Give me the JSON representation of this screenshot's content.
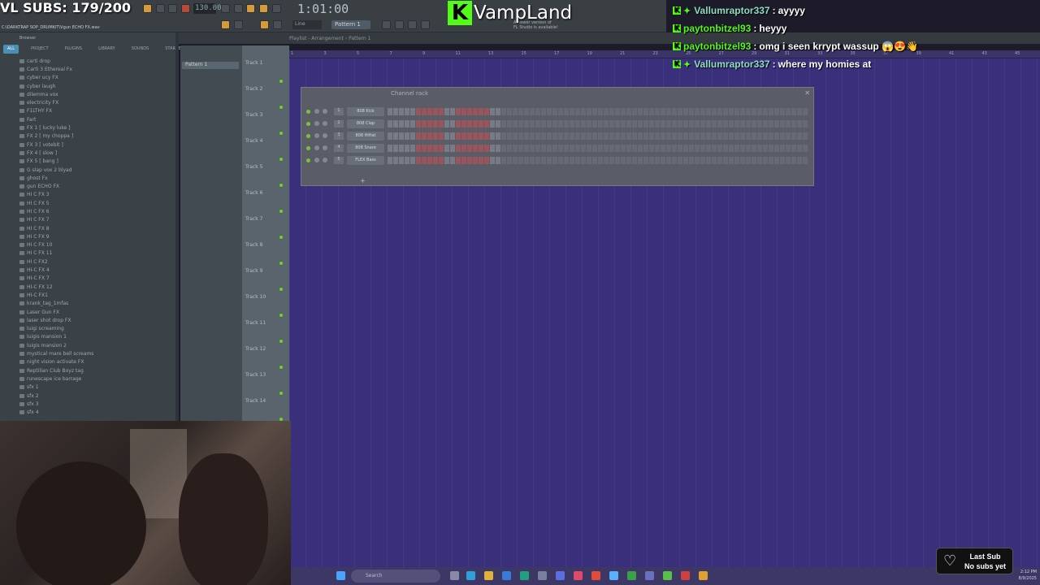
{
  "overlay": {
    "subs_counter": "VL SUBS: 179/200",
    "logo_text": "VampLand"
  },
  "fl": {
    "tempo": "130.000",
    "time": "1:01:00",
    "file_path": "C:\\DARKTRAP SOP_DRUMKIT\\Vgun ECHO FX.wav",
    "snap": "Line",
    "pattern": "Pattern 1",
    "notice_line1": "A newer version of",
    "notice_line2": "FL Studio is available!"
  },
  "chat": [
    {
      "user": "Vallumraptor337",
      "text": "ayyyy",
      "sparkle": true
    },
    {
      "user": "paytonbitzel93",
      "text": "heyyy",
      "sparkle": false
    },
    {
      "user": "paytonbitzel93",
      "text": "omg i seen krrypt wassup 😱😍👋",
      "sparkle": false
    },
    {
      "user": "Vallumraptor337",
      "text": "where my homies at",
      "sparkle": true
    }
  ],
  "browser": {
    "title": "Browser",
    "tabs": [
      "ALL",
      "PROJECT",
      "PLUGINS",
      "LIBRARY",
      "SOUNDS",
      "STARRED"
    ],
    "items": [
      "carti drop",
      "Carti 3 Ethereal Fx",
      "cyber ucy FX",
      "cyber laugh",
      "dilemma vox",
      "electricity FX",
      "F1LTHY FX",
      "Fart",
      "FX 1 [ lucky luke ]",
      "FX 2 [ my choppa ]",
      "FX 3 [ votebit ]",
      "FX 4 [ slow ]",
      "FX 5 [ bang ]",
      "G slap vox 2 blyad",
      "ghost Fx",
      "gun ECHO FX",
      "HI C FX 3",
      "HI C FX 5",
      "HI C FX 6",
      "HI C FX 7",
      "HI C FX 8",
      "HI C FX 9",
      "HI C FX 10",
      "HI C FX 11",
      "HI C FX2",
      "HI-C FX 4",
      "HI-C FX 7",
      "HI-C FX 12",
      "HI-C FX1",
      "krank_tag_1mfas",
      "Laser Gun FX",
      "laser shot drop FX",
      "luigi screaming",
      "luigis mansion 1",
      "luigis mansion 2",
      "mystical mare bell screams",
      "night vision activate FX",
      "Reptilian Club Boyz tag",
      "runescape ice barrage",
      "sfx 1",
      "sfx 2",
      "sfx 3",
      "sfx 4"
    ]
  },
  "playlist": {
    "title": "Playlist - Arrangement › Pattern 1",
    "picker_item": "Pattern 1",
    "tracks": [
      "Track 1",
      "Track 2",
      "Track 3",
      "Track 4",
      "Track 5",
      "Track 6",
      "Track 7",
      "Track 8",
      "Track 9",
      "Track 10",
      "Track 11",
      "Track 12",
      "Track 13",
      "Track 14"
    ],
    "ruler": [
      "1",
      "3",
      "5",
      "7",
      "9",
      "11",
      "13",
      "15",
      "17",
      "19",
      "21",
      "23",
      "25",
      "27",
      "29",
      "31",
      "33",
      "35",
      "37",
      "39",
      "41",
      "43",
      "45"
    ]
  },
  "channel_rack": {
    "title": "Channel rack",
    "channels": [
      {
        "num": "1",
        "name": "808 Kick"
      },
      {
        "num": "2",
        "name": "808 Clap"
      },
      {
        "num": "3",
        "name": "808 HiHat"
      },
      {
        "num": "4",
        "name": "808 Snare"
      },
      {
        "num": "5",
        "name": "FLEX Bass"
      }
    ]
  },
  "taskbar": {
    "search_placeholder": "Search",
    "time": "2:12 PM",
    "date": "8/9/2025"
  },
  "last_sub": {
    "line1": "Last Sub",
    "line2": "No subs yet"
  }
}
